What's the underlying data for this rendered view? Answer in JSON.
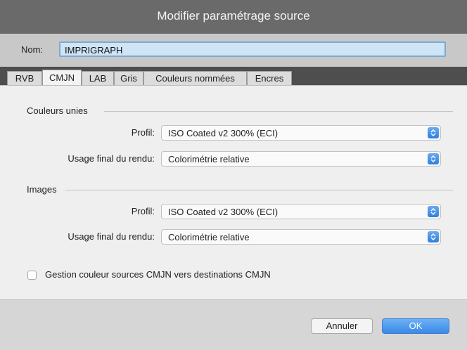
{
  "window": {
    "title": "Modifier paramétrage source"
  },
  "name": {
    "label": "Nom:",
    "value": "IMPRIGRAPH"
  },
  "tabs": [
    {
      "label": "RVB",
      "active": false
    },
    {
      "label": "CMJN",
      "active": true
    },
    {
      "label": "LAB",
      "active": false
    },
    {
      "label": "Gris",
      "active": false
    },
    {
      "label": "Couleurs nommées",
      "active": false
    },
    {
      "label": "Encres",
      "active": false
    }
  ],
  "solid_colors": {
    "heading": "Couleurs unies",
    "profile_label": "Profil:",
    "profile_value": "ISO Coated v2 300% (ECI)",
    "intent_label": "Usage final du rendu:",
    "intent_value": "Colorimétrie relative"
  },
  "images": {
    "heading": "Images",
    "profile_label": "Profil:",
    "profile_value": "ISO Coated v2 300% (ECI)",
    "intent_label": "Usage final du rendu:",
    "intent_value": "Colorimétrie relative"
  },
  "cmyk_management": {
    "label": "Gestion couleur sources CMJN vers destinations CMJN",
    "checked": false
  },
  "buttons": {
    "cancel": "Annuler",
    "ok": "OK"
  },
  "colors": {
    "title_bar": "#6a6a6a",
    "tab_strip": "#4e4e4e",
    "accent": "#3a8ae8"
  }
}
